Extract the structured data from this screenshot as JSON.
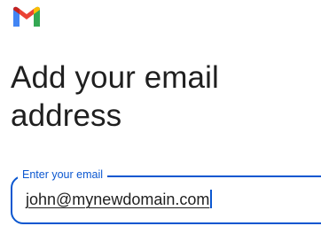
{
  "app": {
    "logo_icon": "gmail-logo-icon",
    "colors": {
      "red": "#ea4335",
      "dark_red": "#c5221f",
      "blue": "#4285f4",
      "green": "#34a853",
      "yellow": "#fbbc04",
      "accent": "#0b57d0"
    }
  },
  "main": {
    "heading_line1": "Add your email",
    "heading_line2": "address"
  },
  "email_field": {
    "label": "Enter your email",
    "value": "john@mynewdomain.com"
  }
}
